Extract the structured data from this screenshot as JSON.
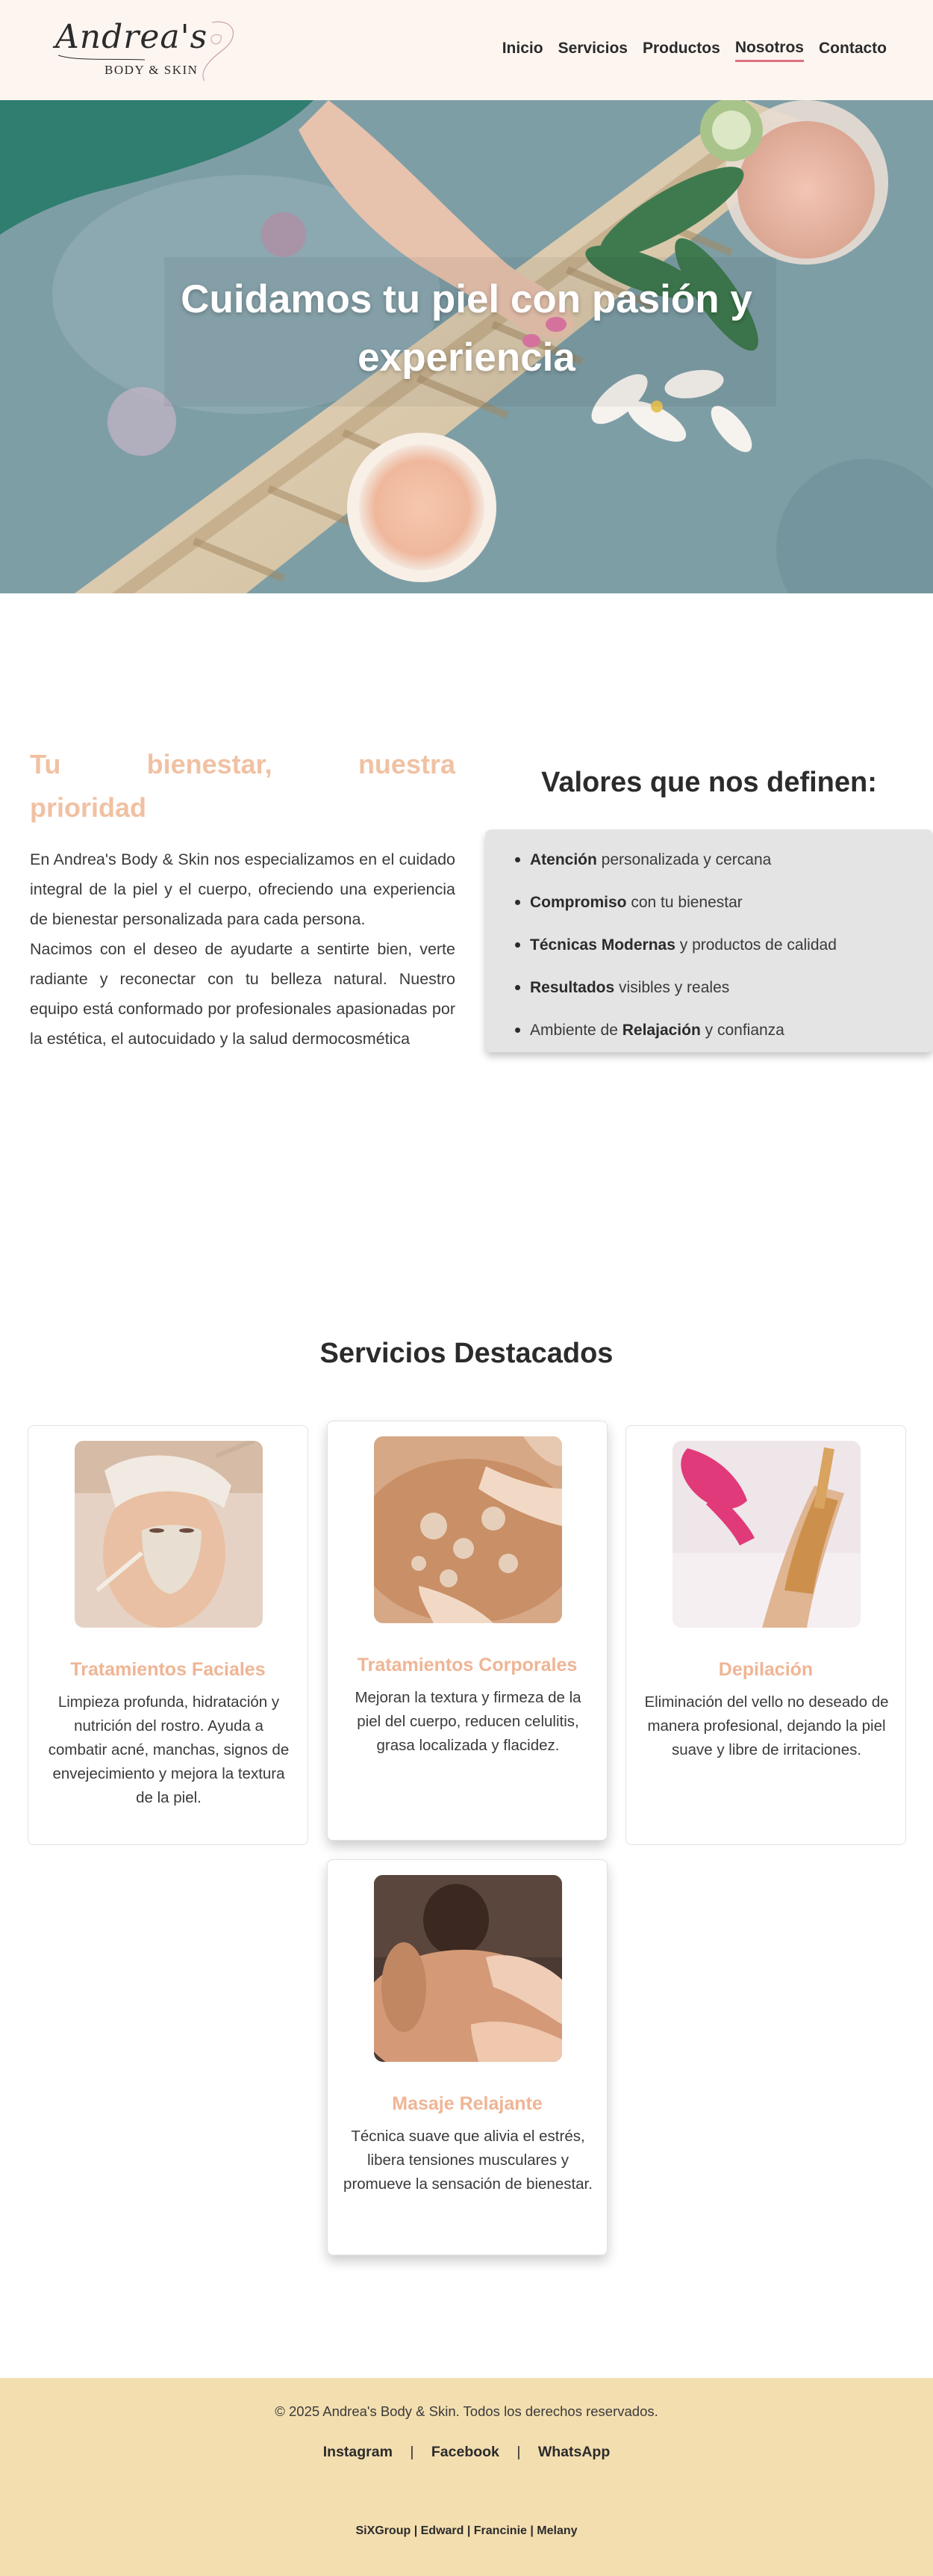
{
  "brand": {
    "logo_script": "Andrea's",
    "logo_sub": "BODY & SKIN"
  },
  "nav": {
    "items": [
      {
        "label": "Inicio"
      },
      {
        "label": "Servicios"
      },
      {
        "label": "Productos"
      },
      {
        "label": "Nosotros",
        "active": true
      },
      {
        "label": "Contacto"
      }
    ]
  },
  "hero": {
    "title_line1": "Cuidamos tu piel con pasión y",
    "title_line2": "experiencia"
  },
  "about": {
    "title_word1": "Tu",
    "title_word2": "bienestar,",
    "title_word3": "nuestra",
    "title_line2": "prioridad",
    "paragraph1": "En Andrea's Body & Skin nos especializamos en el cuidado integral de la piel y el cuerpo, ofreciendo una experiencia de bienestar personalizada para cada persona.",
    "paragraph2": "Nacimos con el deseo de ayudarte a sentirte bien, verte radiante y reconectar con tu belleza natural. Nuestro equipo está conformado por profesionales apasionadas por la estética, el autocuidado y la salud dermocosmética"
  },
  "values": {
    "title": "Valores que nos definen:",
    "items": [
      {
        "bold": "Atención",
        "rest": " personalizada y cercana"
      },
      {
        "bold": "Compromiso",
        "rest": " con tu bienestar"
      },
      {
        "bold": "Técnicas Modernas",
        "rest": " y productos de calidad"
      },
      {
        "bold": "Resultados",
        "rest": " visibles y reales"
      },
      {
        "pre": "Ambiente de ",
        "bold": "Relajación",
        "rest": " y confianza"
      }
    ]
  },
  "services": {
    "title": "Servicios Destacados",
    "cards": [
      {
        "title": "Tratamientos Faciales",
        "text": "Limpieza profunda, hidratación y nutrición del rostro. Ayuda a combatir acné, manchas, signos de envejecimiento y mejora la textura de la piel."
      },
      {
        "title": "Tratamientos Corporales",
        "text": "Mejoran la textura y firmeza de la piel del cuerpo, reducen celulitis, grasa localizada y flacidez."
      },
      {
        "title": "Depilación",
        "text": "Eliminación del vello no deseado de manera profesional, dejando la piel suave y libre de irritaciones."
      },
      {
        "title": "Masaje Relajante",
        "text": "Técnica suave que alivia el estrés, libera tensiones musculares y promueve la sensación de bienestar."
      }
    ]
  },
  "footer": {
    "copyright": "© 2025 Andrea's Body & Skin. Todos los derechos reservados.",
    "social": [
      "Instagram",
      "Facebook",
      "WhatsApp"
    ],
    "separator": "|",
    "credits": "SiXGroup | Edward | Francinie | Melany"
  },
  "colors": {
    "header_bg": "#fdf5f0",
    "accent_peach": "#efb595",
    "nav_active_underline": "#e0707f",
    "values_box_bg": "#e4e4e4",
    "footer_bg": "#f3deb0"
  }
}
